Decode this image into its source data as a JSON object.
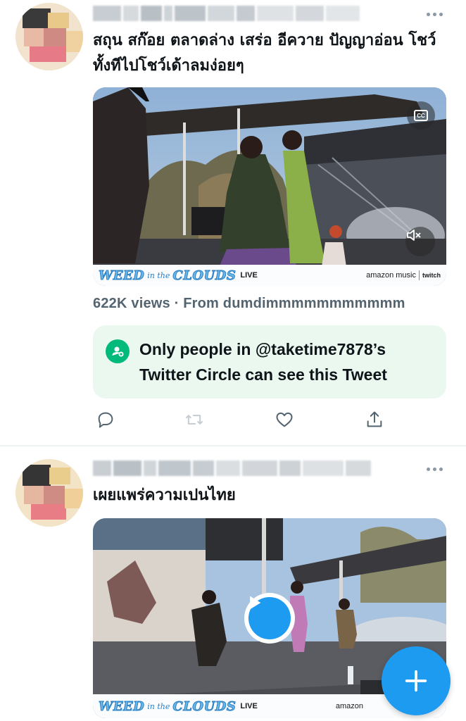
{
  "colors": {
    "accent": "#1d9bf0",
    "circle_green": "#00ba7c",
    "circle_bg": "#eaf8f0",
    "secondary_text": "#536471",
    "icon_gray": "#536471"
  },
  "tweets": [
    {
      "author_name": "",
      "author_handle": "",
      "text": "สถุน สก๊อย ตลาดล่าง เสร่อ อีควาย ปัญญาอ่อน โชว์ทั้งทีไปโชว์เด้าลมง่อยๆ",
      "media": {
        "icon": "video-thumbnail",
        "banner_title": "WEED",
        "banner_in_the": "in the",
        "banner_title2": "CLOUDS",
        "banner_live": "LIVE",
        "banner_sponsor": "amazon music",
        "banner_platform": "twitch",
        "cc_icon": "closed-captions-icon",
        "cc_label": "CC",
        "mute_icon": "muted-speaker-icon"
      },
      "views_text": "622K views · From dumdimmmmmmmmmmm",
      "circle_notice": {
        "icon": "twitter-circle-icon",
        "text": "Only people in @taketime7878’s Twitter Circle can see this Tweet"
      },
      "actions": [
        {
          "icon": "reply-icon"
        },
        {
          "icon": "retweet-icon"
        },
        {
          "icon": "like-icon"
        },
        {
          "icon": "share-icon"
        }
      ]
    },
    {
      "author_name": "",
      "author_handle": "",
      "text": "เผยแพร่ความเปนไทย",
      "media": {
        "icon": "video-thumbnail",
        "play_icon": "play-icon",
        "banner_title": "WEED",
        "banner_in_the": "in the",
        "banner_title2": "CLOUDS",
        "banner_live": "LIVE",
        "banner_sponsor": "amazon"
      }
    }
  ],
  "fab": {
    "icon": "compose-plus-icon",
    "label": "+"
  }
}
